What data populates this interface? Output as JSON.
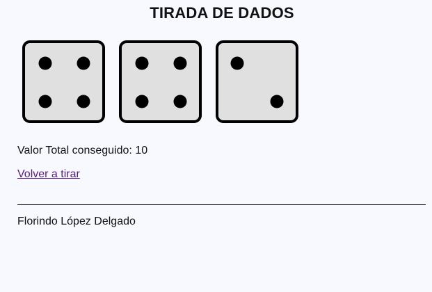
{
  "page": {
    "title": "TIRADA DE DADOS"
  },
  "dice": [
    {
      "value": 4
    },
    {
      "value": 4
    },
    {
      "value": 2
    }
  ],
  "result": {
    "total_label": "Valor Total conseguido:",
    "total_value": 10
  },
  "actions": {
    "reroll_label": "Volver a tirar"
  },
  "footer": {
    "author": "Florindo López Delgado"
  },
  "colors": {
    "background": "#f8f8ff",
    "die_face": "#e0e0e0",
    "pip": "#000000",
    "visited_link": "#551a8b"
  }
}
